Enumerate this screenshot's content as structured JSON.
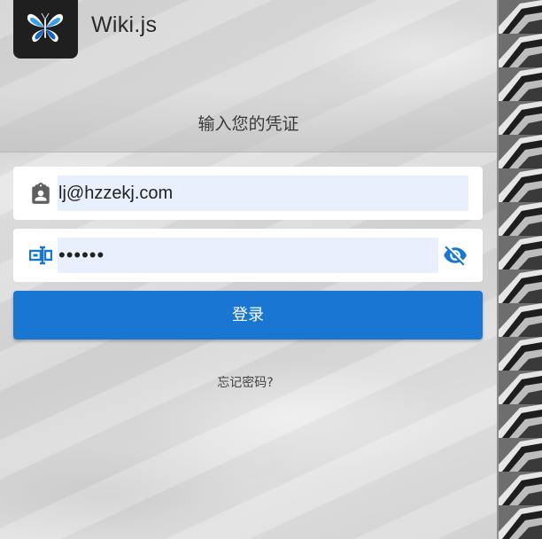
{
  "app": {
    "title": "Wiki.js",
    "logo_icon": "butterfly-logo-icon"
  },
  "login": {
    "subtitle": "输入您的凭证",
    "email": {
      "value": "lj@hzzekj.com",
      "icon": "account-box-icon"
    },
    "password": {
      "value": "••••••",
      "icon": "password-field-icon",
      "toggle_icon": "eye-off-icon"
    },
    "submit_label": "登录",
    "forgot_label": "忘记密码?"
  },
  "colors": {
    "primary": "#1976d2",
    "input_autofill_bg": "#e8f0fe",
    "logo_bg": "#1f1f1f"
  }
}
